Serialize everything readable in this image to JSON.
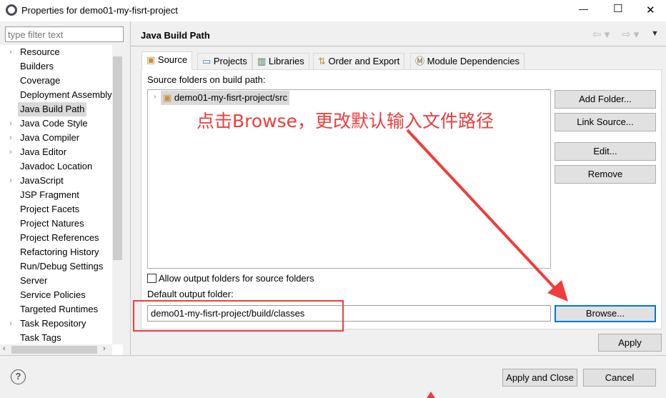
{
  "window": {
    "title": "Properties for demo01-my-fisrt-project",
    "minimize": "—",
    "maximize": "☐",
    "close": "✕"
  },
  "sidebar": {
    "filter_placeholder": "type filter text",
    "items": [
      {
        "label": "Resource",
        "expandable": true
      },
      {
        "label": "Builders"
      },
      {
        "label": "Coverage"
      },
      {
        "label": "Deployment Assembly"
      },
      {
        "label": "Java Build Path",
        "selected": true
      },
      {
        "label": "Java Code Style",
        "expandable": true
      },
      {
        "label": "Java Compiler",
        "expandable": true
      },
      {
        "label": "Java Editor",
        "expandable": true
      },
      {
        "label": "Javadoc Location"
      },
      {
        "label": "JavaScript",
        "expandable": true
      },
      {
        "label": "JSP Fragment"
      },
      {
        "label": "Project Facets"
      },
      {
        "label": "Project Natures"
      },
      {
        "label": "Project References"
      },
      {
        "label": "Refactoring History"
      },
      {
        "label": "Run/Debug Settings"
      },
      {
        "label": "Server"
      },
      {
        "label": "Service Policies"
      },
      {
        "label": "Targeted Runtimes"
      },
      {
        "label": "Task Repository",
        "expandable": true
      },
      {
        "label": "Task Tags"
      }
    ]
  },
  "page": {
    "title": "Java Build Path",
    "tabs": [
      {
        "label": "Source",
        "active": true
      },
      {
        "label": "Projects"
      },
      {
        "label": "Libraries"
      },
      {
        "label": "Order and Export"
      },
      {
        "label": "Module Dependencies"
      }
    ],
    "source_label": "Source folders on build path:",
    "source_items": [
      "demo01-my-fisrt-project/src"
    ],
    "buttons": {
      "add_folder": "Add Folder...",
      "link_source": "Link Source...",
      "edit": "Edit...",
      "remove": "Remove",
      "browse": "Browse...",
      "apply": "Apply"
    },
    "allow_output_label": "Allow output folders for source folders",
    "allow_output_checked": false,
    "output_label": "Default output folder:",
    "output_value": "demo01-my-fisrt-project/build/classes"
  },
  "footer": {
    "help": "?",
    "apply_close": "Apply and Close",
    "cancel": "Cancel"
  },
  "annotation": {
    "text": "点击Browse，更改默认输入文件路径",
    "color": "#f03c3c"
  }
}
